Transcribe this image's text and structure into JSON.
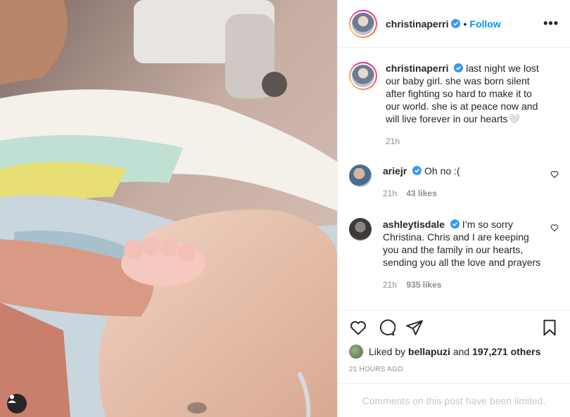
{
  "post": {
    "author": {
      "username": "christinaperri",
      "verified": true,
      "follow_label": "Follow",
      "separator": "•"
    },
    "more_label": "•••",
    "caption": {
      "username": "christinaperri",
      "text": "last night we lost our baby girl. she was born silent after fighting so hard to make it to our world. she is at peace now and will live forever in our hearts🤍",
      "time": "21h"
    },
    "comments": [
      {
        "username": "ariejr",
        "text": "Oh no :(",
        "time": "21h",
        "likes": "43 likes"
      },
      {
        "username": "ashleytisdale",
        "text": "I’m so sorry Christina. Chris and I are keeping you and the family in our hearts, sending you all the love and prayers",
        "time": "21h",
        "likes": "935 likes"
      }
    ],
    "likes": {
      "prefix": "Liked by",
      "user": "bellapuzi",
      "middle": "and",
      "others": "197,271 others"
    },
    "time_ago": "21 HOURS AGO",
    "comments_limited": "Comments on this post have been limited."
  },
  "icons": {
    "like": "heart-outline-icon",
    "comment": "speech-bubble-icon",
    "share": "paper-plane-icon",
    "save": "bookmark-icon",
    "tag": "user-tag-icon",
    "verified": "verified-badge-icon"
  },
  "colors": {
    "follow": "#0095f6",
    "verified": "#3897f0",
    "muted": "#8e8e8e"
  }
}
